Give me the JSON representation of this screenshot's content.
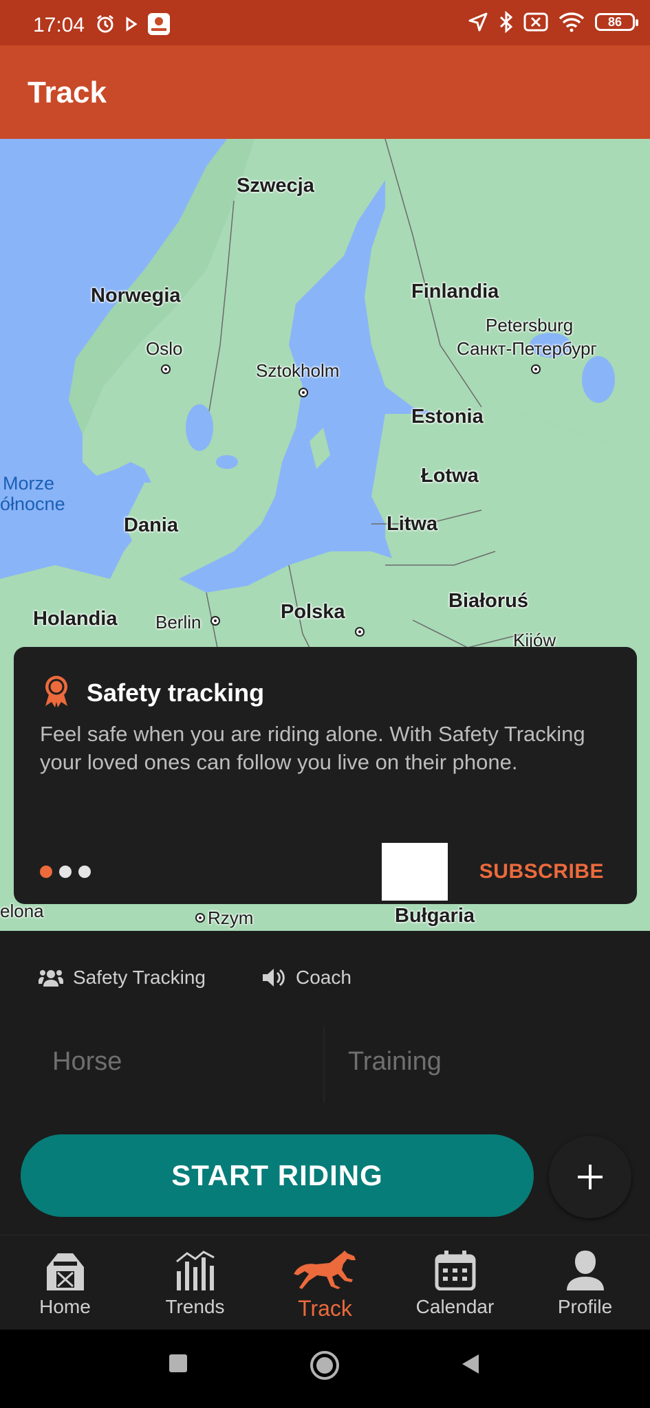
{
  "status_bar": {
    "time": "17:04",
    "battery": "86"
  },
  "app_bar": {
    "title": "Track"
  },
  "map": {
    "labels": {
      "szwecja": "Szwecja",
      "norwegia": "Norwegia",
      "finlandia": "Finlandia",
      "petersburg": "Petersburg",
      "petersburg_ru": "Санкт-Петербург",
      "oslo": "Oslo",
      "sztokholm": "Sztokholm",
      "estonia": "Estonia",
      "lotwa": "Łotwa",
      "morze1": "Morze",
      "morze2": "ółnocne",
      "dania": "Dania",
      "litwa": "Litwa",
      "bialorus": "Białoruś",
      "holandia": "Holandia",
      "berlin": "Berlin",
      "polska": "Polska",
      "kijow": "Kijów",
      "elona": "elona",
      "rzym": "Rzym",
      "bulgaria": "Bułgaria"
    }
  },
  "promo": {
    "title": "Safety tracking",
    "body": "Feel safe when you are riding alone. With Safety Tracking your loved ones can follow you live on their phone.",
    "subscribe": "SUBSCRIBE",
    "page_count": 3,
    "active_page": 1
  },
  "options": {
    "safety_tracking": "Safety Tracking",
    "coach": "Coach"
  },
  "selectors": {
    "horse_placeholder": "Horse",
    "training_placeholder": "Training"
  },
  "start_button": "START RIDING",
  "add_button": "+",
  "nav": {
    "home": "Home",
    "trends": "Trends",
    "track": "Track",
    "calendar": "Calendar",
    "profile": "Profile"
  },
  "colors": {
    "status_bar": "#b5371c",
    "app_bar": "#c94a28",
    "accent": "#ec6a3c",
    "start_button": "#067d79",
    "background": "#1c1c1c"
  }
}
